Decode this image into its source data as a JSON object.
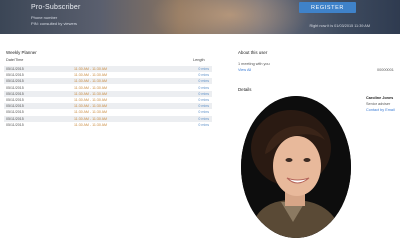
{
  "hero": {
    "title": "Pro-Subscriber",
    "line1": "Phone number",
    "line2": "PIN: consulted by viewers",
    "register_label": "REGISTER",
    "note": "Right now it is 01/03/2015 11:39 AM"
  },
  "left": {
    "title": "Weekly Planner",
    "col_date": "Date/Time",
    "col_length": "Length",
    "rows": [
      {
        "date": "05/11/2015",
        "time": "11:30 AM - 11:30 AM",
        "length": "0 mins"
      },
      {
        "date": "05/11/2015",
        "time": "11:30 AM - 11:30 AM",
        "length": "0 mins"
      },
      {
        "date": "05/11/2015",
        "time": "11:30 AM - 11:30 AM",
        "length": "0 mins"
      },
      {
        "date": "05/11/2015",
        "time": "11:30 AM - 11:30 AM",
        "length": "0 mins"
      },
      {
        "date": "05/11/2015",
        "time": "11:30 AM - 11:30 AM",
        "length": "0 mins"
      },
      {
        "date": "05/11/2015",
        "time": "11:30 AM - 11:30 AM",
        "length": "0 mins"
      },
      {
        "date": "05/11/2015",
        "time": "11:30 AM - 11:30 AM",
        "length": "0 mins"
      },
      {
        "date": "05/11/2015",
        "time": "11:30 AM - 11:30 AM",
        "length": "0 mins"
      },
      {
        "date": "05/11/2015",
        "time": "11:30 AM - 11:30 AM",
        "length": "0 mins"
      },
      {
        "date": "05/11/2015",
        "time": "11:30 AM - 11:30 AM",
        "length": "0 mins"
      }
    ]
  },
  "right": {
    "about_title": "About this user",
    "about_line": "1 meeting with you",
    "about_link": "View All",
    "about_count": "00000001",
    "details_title": "Details",
    "profile_name": "Caroline Jones",
    "profile_line1": "Senior adviser",
    "profile_line2": "Contact by Email",
    "colors": {
      "link": "#3a7bd5",
      "accent": "#3f82c9"
    }
  }
}
